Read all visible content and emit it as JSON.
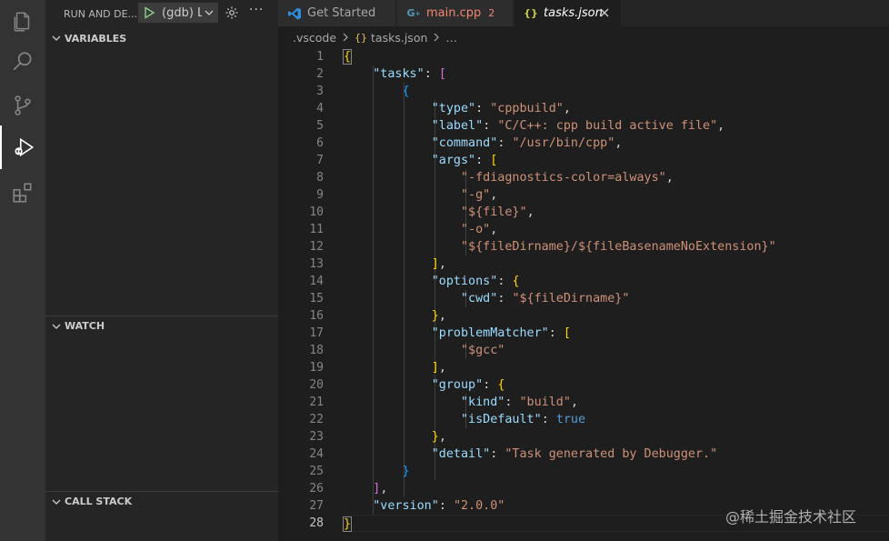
{
  "sidebar": {
    "title": "RUN AND DE...",
    "debug_config": "(gdb) L",
    "more": "···",
    "sections": [
      "VARIABLES",
      "WATCH",
      "CALL STACK"
    ]
  },
  "tabs": [
    {
      "label": "Get Started",
      "icon": "vscode-icon"
    },
    {
      "label": "main.cpp",
      "badge": "2",
      "icon": "cpp-icon"
    },
    {
      "label": "tasks.json",
      "icon": "json-icon"
    }
  ],
  "breadcrumb": {
    "folder": ".vscode",
    "file": "tasks.json",
    "tail": "…"
  },
  "editor": {
    "line_numbers": [
      "1",
      "2",
      "3",
      "4",
      "5",
      "6",
      "7",
      "8",
      "9",
      "10",
      "11",
      "12",
      "13",
      "14",
      "15",
      "16",
      "17",
      "18",
      "19",
      "20",
      "21",
      "22",
      "23",
      "24",
      "25",
      "26",
      "27",
      "28"
    ],
    "tokens": {
      "tasks": "\"tasks\"",
      "type_key": "\"type\"",
      "type_val": "\"cppbuild\"",
      "label_key": "\"label\"",
      "label_val": "\"C/C++: cpp build active file\"",
      "command_key": "\"command\"",
      "command_val": "\"/usr/bin/cpp\"",
      "args_key": "\"args\"",
      "arg1": "\"-fdiagnostics-color=always\"",
      "arg2": "\"-g\"",
      "arg3": "\"${file}\"",
      "arg4": "\"-o\"",
      "arg5": "\"${fileDirname}/${fileBasenameNoExtension}\"",
      "options_key": "\"options\"",
      "cwd_key": "\"cwd\"",
      "cwd_val": "\"${fileDirname}\"",
      "problem_key": "\"problemMatcher\"",
      "problem_val": "\"$gcc\"",
      "group_key": "\"group\"",
      "kind_key": "\"kind\"",
      "kind_val": "\"build\"",
      "isdefault_key": "\"isDefault\"",
      "isdefault_val": "true",
      "detail_key": "\"detail\"",
      "detail_val": "\"Task generated by Debugger.\"",
      "version_key": "\"version\"",
      "version_val": "\"2.0.0\""
    }
  },
  "watermark": "@稀土掘金技术社区",
  "colors": {
    "activity_bar": "#333333",
    "sidebar": "#252526",
    "editor": "#1e1e1e",
    "json_key": "#9cdcfe",
    "json_string": "#ce9178",
    "json_bool": "#569cd6",
    "bracket_1": "#ffd700",
    "bracket_2": "#da70d6",
    "bracket_3": "#179fff",
    "error_tab": "#f48771"
  }
}
